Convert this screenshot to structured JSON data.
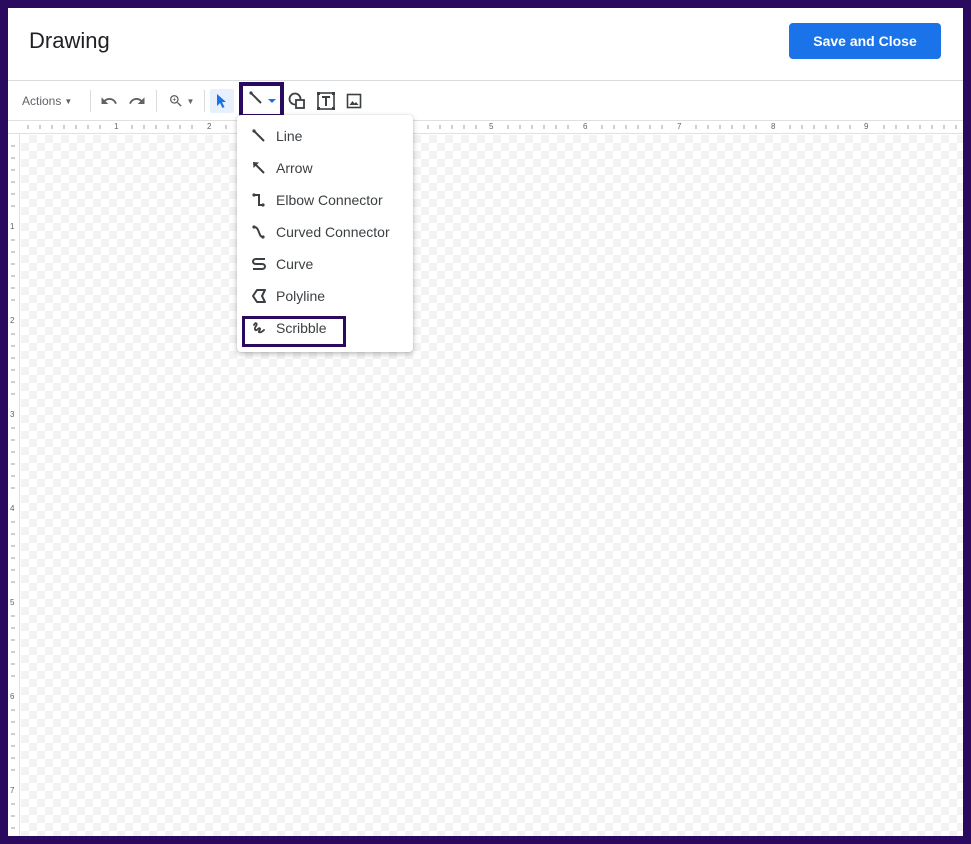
{
  "header": {
    "title": "Drawing",
    "save_label": "Save and Close"
  },
  "toolbar": {
    "actions_label": "Actions",
    "undo_icon": "undo-icon",
    "redo_icon": "redo-icon",
    "zoom_icon": "zoom-in-icon",
    "select_icon": "select-arrow-icon",
    "line_icon": "line-icon",
    "shape_icon": "shape-icon",
    "textbox_icon": "text-box-icon",
    "image_icon": "image-icon"
  },
  "ruler": {
    "top_numbers": [
      "1",
      "2",
      "5",
      "6",
      "7",
      "8",
      "9"
    ],
    "left_numbers": [
      "1",
      "2",
      "3",
      "4",
      "5",
      "6",
      "7"
    ]
  },
  "line_menu": {
    "items": [
      {
        "label": "Line",
        "icon": "line-icon"
      },
      {
        "label": "Arrow",
        "icon": "arrow-icon"
      },
      {
        "label": "Elbow Connector",
        "icon": "elbow-connector-icon"
      },
      {
        "label": "Curved Connector",
        "icon": "curved-connector-icon"
      },
      {
        "label": "Curve",
        "icon": "curve-icon"
      },
      {
        "label": "Polyline",
        "icon": "polyline-icon"
      },
      {
        "label": "Scribble",
        "icon": "scribble-icon"
      }
    ]
  },
  "colors": {
    "accent": "#1a73e8",
    "highlight": "#2a0a5e"
  }
}
